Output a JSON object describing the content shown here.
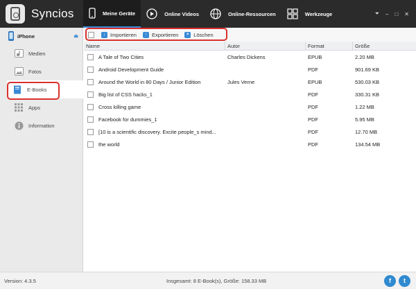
{
  "app": {
    "title": "Syncios"
  },
  "nav": [
    {
      "label": "Meine Geräte",
      "icon": "phone-icon"
    },
    {
      "label": "Online Videos",
      "icon": "play-icon"
    },
    {
      "label": "Online-Ressourcen",
      "icon": "globe-icon"
    },
    {
      "label": "Werkzeuge",
      "icon": "grid-icon"
    }
  ],
  "window_controls": {
    "menu": "⏷",
    "minimize": "–",
    "maximize": "□",
    "close": "✕"
  },
  "sidebar": {
    "device": "iPhone",
    "items": [
      {
        "label": "Medien",
        "icon": "music-icon"
      },
      {
        "label": "Fotos",
        "icon": "photo-icon"
      },
      {
        "label": "E-Books",
        "icon": "book-icon"
      },
      {
        "label": "Apps",
        "icon": "apps-icon"
      },
      {
        "label": "Information",
        "icon": "info-icon"
      }
    ]
  },
  "toolbar": {
    "import": "Importieren",
    "export": "Exportieren",
    "delete": "Löschen"
  },
  "table": {
    "columns": [
      "Name",
      "Autor",
      "Format",
      "Größe"
    ],
    "rows": [
      {
        "name": "A Tale of Two Cities",
        "autor": "Charles Dickens",
        "format": "EPUB",
        "size": "2.20 MB"
      },
      {
        "name": "Android Development Guide",
        "autor": "",
        "format": "PDF",
        "size": "901.69 KB"
      },
      {
        "name": "Around the World in 80 Days / Junior Edition",
        "autor": "Jules Verne",
        "format": "EPUB",
        "size": "530.03 KB"
      },
      {
        "name": "Big list of CSS hacks_1",
        "autor": "",
        "format": "PDF",
        "size": "330.31 KB"
      },
      {
        "name": "Cross killing game",
        "autor": "",
        "format": "PDF",
        "size": "1.22 MB"
      },
      {
        "name": "Facebook for dummies_1",
        "autor": "",
        "format": "PDF",
        "size": "5.95 MB"
      },
      {
        "name": "[10 is a scientific discovery. Excite people_s mind...",
        "autor": "",
        "format": "PDF",
        "size": "12.70 MB"
      },
      {
        "name": "the world",
        "autor": "",
        "format": "PDF",
        "size": "134.54 MB"
      }
    ]
  },
  "status": {
    "version": "Version: 4.3.5",
    "summary": "Insgesamt: 8 E-Book(s), Größe: 158.33 MB"
  },
  "colors": {
    "accent": "#3a8ad6",
    "highlight": "#d9302c",
    "topbar": "#2b2b2b"
  }
}
